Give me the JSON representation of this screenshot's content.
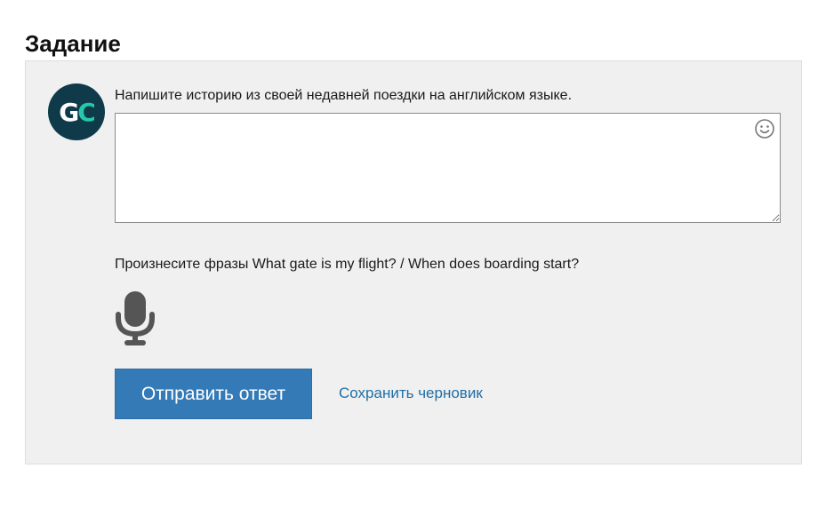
{
  "page": {
    "title": "Задание"
  },
  "task": {
    "avatar": {
      "initial_1": "G",
      "initial_2": "C",
      "colors": {
        "background": "#0f3a4a",
        "initial_1": "#ffffff",
        "initial_2": "#23c9a8"
      }
    },
    "prompt": "Напишите историю из своей недавней поездки на английском языке.",
    "answer_input": {
      "value": "",
      "placeholder": "",
      "icon": "emoji-smile-icon"
    },
    "speech": {
      "prompt": "Произнесите фразы What gate is my flight? / When does boarding start?",
      "icon": "microphone-icon"
    },
    "actions": {
      "submit_label": "Отправить ответ",
      "save_draft_label": "Сохранить черновик"
    }
  },
  "colors": {
    "panel_background": "#f0f0f0",
    "primary_button": "#337ab7",
    "link": "#1f6fa6",
    "icon": "#555555"
  }
}
